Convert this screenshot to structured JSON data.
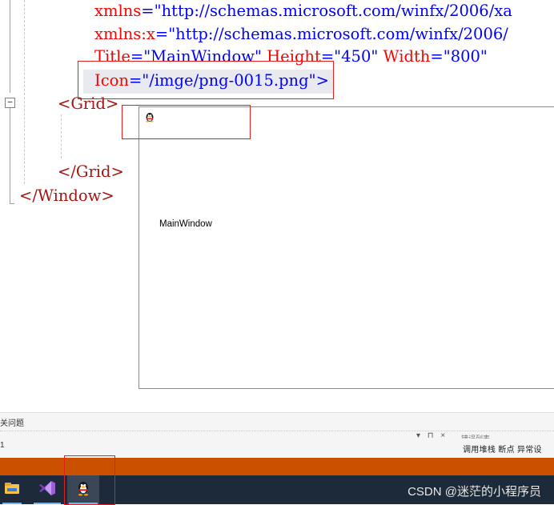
{
  "editor": {
    "lines": [
      {
        "attr": "xmlns",
        "eq": "=",
        "value": "\"http://schemas.microsoft.com/winfx/2006/xa"
      },
      {
        "attr": "xmlns:x",
        "eq": "=",
        "value": "\"http://schemas.microsoft.com/winfx/2006/"
      },
      {
        "attr1": "Title",
        "val1": "\"MainWindow\"",
        "attr2": "Height",
        "val2": "\"450\"",
        "attr3": "Width",
        "val3": "\"800\""
      },
      {
        "attr": "Icon",
        "eq": "=",
        "value": "\"/imge/png-0015.png\"",
        "close": ">"
      }
    ],
    "grid_open": "<Grid>",
    "grid_close": "</Grid>",
    "window_close": "</Window>",
    "fold_symbol": "−"
  },
  "app_window": {
    "title": "MainWindow",
    "icon": "qq-penguin-icon"
  },
  "panel": {
    "title": "关问题",
    "field_value": "1",
    "tools": "▾ ⊓ ×",
    "tab_partial": "错误列表",
    "right_tabs": "调用堆栈  断点  异常设"
  },
  "taskbar": {
    "items": [
      "file-explorer-icon",
      "visual-studio-icon",
      "qq-penguin-icon"
    ]
  },
  "watermark": "CSDN @迷茫的小程序员",
  "colors": {
    "status_bar": "#ca5100",
    "taskbar": "#1d2a3a",
    "annotation_box": "#e02020"
  }
}
